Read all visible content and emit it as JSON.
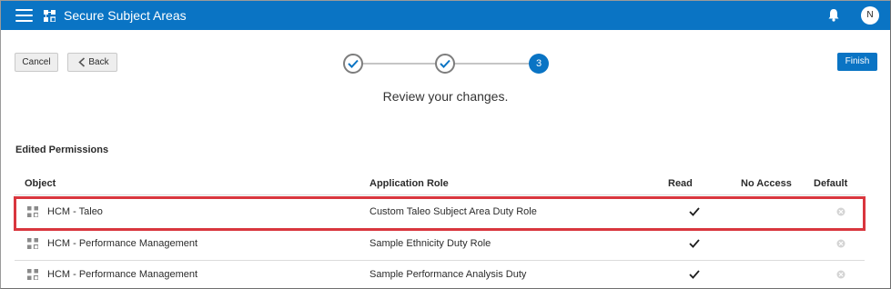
{
  "header": {
    "title": "Secure Subject Areas",
    "avatar_initial": "N",
    "accent": "#0a74c4"
  },
  "toolbar": {
    "cancel_label": "Cancel",
    "back_label": "Back",
    "finish_label": "Finish"
  },
  "train": {
    "steps": [
      {
        "state": "complete",
        "icon": "checkmark-icon"
      },
      {
        "state": "complete",
        "icon": "checkmark-icon"
      },
      {
        "state": "current",
        "label": "3"
      }
    ],
    "message": "Review your changes."
  },
  "section": {
    "title": "Edited Permissions"
  },
  "table": {
    "columns": {
      "object": "Object",
      "role": "Application Role",
      "read": "Read",
      "no_access": "No Access",
      "default": "Default"
    },
    "rows": [
      {
        "object": "HCM - Taleo",
        "role": "Custom Taleo Subject Area Duty Role",
        "read": true,
        "no_access": false,
        "default_icon": "clear-circle-icon",
        "highlighted": true
      },
      {
        "object": "HCM - Performance Management",
        "role": "Sample Ethnicity Duty Role",
        "read": true,
        "no_access": false,
        "default_icon": "clear-circle-icon",
        "highlighted": false
      },
      {
        "object": "HCM - Performance Management",
        "role": "Sample Performance Analysis Duty",
        "read": true,
        "no_access": false,
        "default_icon": "clear-circle-icon",
        "highlighted": false
      }
    ]
  },
  "colors": {
    "highlight": "#d9363e",
    "primary_button": "#0a74c4"
  }
}
